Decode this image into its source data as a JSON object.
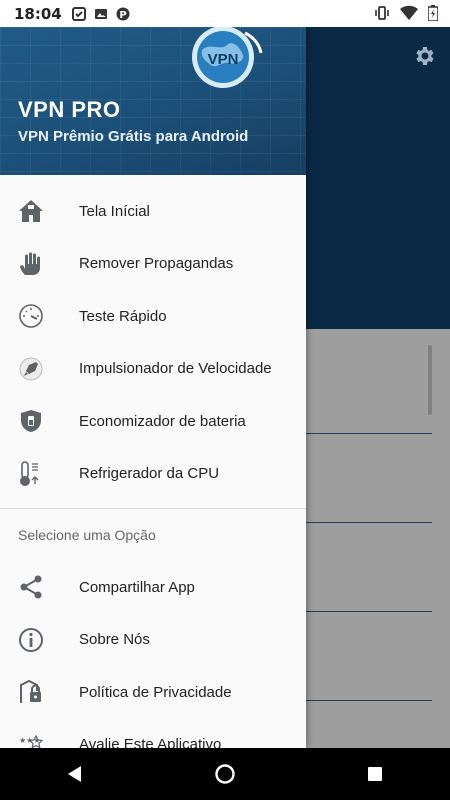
{
  "status_bar": {
    "time": "18:04",
    "left_icons": [
      "checklist-icon",
      "image-icon",
      "p-badge-icon"
    ],
    "right_icons": [
      "vibrate-icon",
      "wifi-icon",
      "battery-icon"
    ]
  },
  "drawer": {
    "app_title": "VPN PRO",
    "app_subtitle": "VPN Prêmio Grátis para Android",
    "logo_text": "VPN",
    "items": [
      {
        "label": "Tela Inícial",
        "icon": "home-icon"
      },
      {
        "label": "Remover Propagandas",
        "icon": "hand-stop-icon"
      },
      {
        "label": "Teste Rápido",
        "icon": "speedometer-icon"
      },
      {
        "label": "Impulsionador de Velocidade",
        "icon": "rocket-icon"
      },
      {
        "label": "Economizador de bateria",
        "icon": "battery-saver-icon"
      },
      {
        "label": "Refrigerador da CPU",
        "icon": "thermometer-icon"
      }
    ],
    "section_title": "Selecione uma Opção",
    "section_items": [
      {
        "label": "Compartilhar App",
        "icon": "share-icon"
      },
      {
        "label": "Sobre Nós",
        "icon": "info-icon"
      },
      {
        "label": "Política de Privacidade",
        "icon": "privacy-lock-icon"
      },
      {
        "label": "Avalie Este Aplicativo",
        "icon": "rate-stars-icon"
      }
    ]
  },
  "background_app": {
    "settings_icon": "gear-icon",
    "header_color": "#0e3f6b"
  },
  "nav_bar": {
    "buttons": [
      "back-icon",
      "home-circle-icon",
      "recents-square-icon"
    ]
  },
  "colors": {
    "drawer_header": "#1c4f78",
    "icon": "#5f6368",
    "text": "#222222"
  }
}
